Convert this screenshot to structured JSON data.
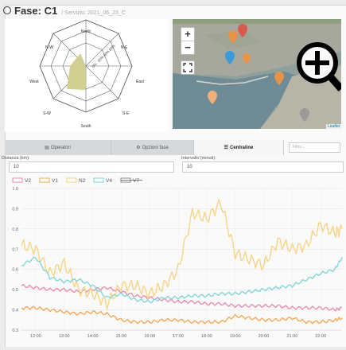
{
  "header": {
    "title": "Fase: C1",
    "separator": "/",
    "service": "Servizio: 2021_06_23_C"
  },
  "wind_rose": {
    "directions": [
      "North",
      "N-E",
      "East",
      "S-E",
      "South",
      "S-W",
      "West",
      "N-W"
    ],
    "ring_labels": [
      "0%",
      "20%",
      "40%",
      "60%"
    ],
    "dominant_sector": "S-W",
    "fill_color": "#cfcd8c"
  },
  "map": {
    "zoom_in": "+",
    "zoom_out": "−",
    "attribution": "Leaflet",
    "zoom_icon": "zoom-in-magnifier-icon",
    "marker_colors": [
      "#e8924c",
      "#d85a4e",
      "#3a9bd8",
      "#9a9a9a"
    ]
  },
  "tabs": [
    {
      "label": "Operatori",
      "icon": "list-icon",
      "active": false
    },
    {
      "label": "Opzioni fase",
      "icon": "settings-icon",
      "active": false
    },
    {
      "label": "Centraline",
      "icon": "wifi-icon",
      "active": true
    }
  ],
  "filter": {
    "placeholder": "Filtro..."
  },
  "fields": {
    "distance_label": "Distanza (km):",
    "distance_value": "10",
    "interval_label": "Intervallo (minuti):",
    "interval_value": "10"
  },
  "chart_data": {
    "type": "line",
    "x": [
      "11:30",
      "12:00",
      "12:30",
      "13:00",
      "13:30",
      "14:00",
      "14:30",
      "15:00",
      "15:30",
      "16:00",
      "16:30",
      "17:00",
      "17:30",
      "18:00",
      "18:30",
      "19:00",
      "19:30",
      "20:00",
      "20:30",
      "21:00",
      "21:30",
      "22:00",
      "22:30",
      "22:45"
    ],
    "x_ticks": [
      "12:00",
      "13:00",
      "14:00",
      "15:00",
      "16:00",
      "17:00",
      "18:00",
      "19:00",
      "20:00",
      "21:00",
      "22:00"
    ],
    "y_ticks": [
      "0.3",
      "0.4",
      "0.5",
      "0.6",
      "0.7",
      "0.8",
      "0.9",
      "1.0"
    ],
    "ylim": [
      0.3,
      1.0
    ],
    "grid": true,
    "legend_position": "top-left",
    "series": [
      {
        "name": "V2",
        "color": "#e98aa6",
        "hidden": false,
        "values": [
          0.52,
          0.51,
          0.5,
          0.5,
          0.49,
          0.5,
          0.51,
          0.49,
          0.47,
          0.46,
          0.45,
          0.44,
          0.44,
          0.43,
          0.43,
          0.42,
          0.42,
          0.42,
          0.42,
          0.41,
          0.41,
          0.41,
          0.4,
          0.41
        ]
      },
      {
        "name": "V1",
        "color": "#f5a54f",
        "hidden": false,
        "values": [
          0.41,
          0.41,
          0.4,
          0.39,
          0.38,
          0.39,
          0.38,
          0.35,
          0.34,
          0.34,
          0.35,
          0.35,
          0.34,
          0.34,
          0.34,
          0.37,
          0.36,
          0.35,
          0.35,
          0.36,
          0.34,
          0.34,
          0.35,
          0.36
        ]
      },
      {
        "name": "N2",
        "color": "#f7d281",
        "hidden": false,
        "values": [
          0.72,
          0.7,
          0.58,
          0.63,
          0.5,
          0.48,
          0.43,
          0.52,
          0.52,
          0.48,
          0.52,
          0.6,
          0.88,
          0.85,
          0.93,
          0.68,
          0.65,
          0.62,
          0.74,
          0.7,
          0.72,
          0.82,
          0.78,
          0.8
        ]
      },
      {
        "name": "V4",
        "color": "#7ed4d6",
        "hidden": false,
        "values": [
          0.62,
          0.66,
          0.56,
          0.54,
          0.55,
          0.52,
          0.46,
          0.48,
          0.45,
          0.44,
          0.46,
          0.46,
          0.47,
          0.47,
          0.48,
          0.48,
          0.49,
          0.5,
          0.51,
          0.52,
          0.55,
          0.58,
          0.6,
          0.66
        ]
      },
      {
        "name": "V7",
        "color": "#888888",
        "hidden": true,
        "values": []
      }
    ]
  }
}
